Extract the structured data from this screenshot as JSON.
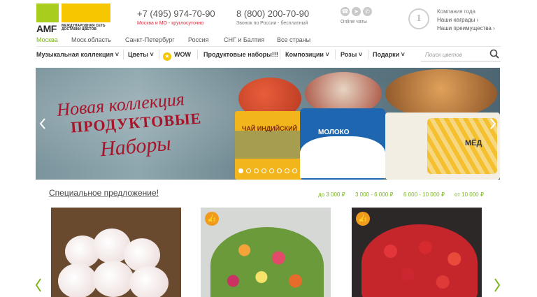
{
  "header": {
    "logo_text": "AMF",
    "logo_tagline": "Международная сеть доставки цветов",
    "phone1": "+7 (495) 974-70-90",
    "phone1_note": "Москва и МО - круглосуточно",
    "phone2": "8 (800) 200-70-90",
    "phone2_note": "Звонок по России - бесплатный",
    "chats_label": "Online чаты",
    "chat_icons": [
      "viber-icon",
      "telegram-icon",
      "whatsapp-icon"
    ],
    "company_title": "Компания года",
    "company_link1": "Наши награды ›",
    "company_link2": "Наши преимущества ›"
  },
  "cities": [
    "Москва",
    "Моск.область",
    "Санкт-Петербург",
    "Россия",
    "СНГ и Балтия",
    "Все страны"
  ],
  "nav": {
    "items": [
      {
        "label": "Музыкальная коллекция ˅"
      },
      {
        "label": "Цветы ˅"
      },
      {
        "label": "WOW"
      },
      {
        "label": "Продуктовые наборы!!!"
      },
      {
        "label": "Композиции ˅"
      },
      {
        "label": "Розы ˅"
      },
      {
        "label": "Подарки ˅"
      }
    ],
    "search_placeholder": "Поиск цветов"
  },
  "banner": {
    "line1": "Новая коллекция",
    "line2": "ПРОДУКТОВЫЕ",
    "line3": "Наборы",
    "box1_text": "ЧАЙ ИНДИЙСКИЙ",
    "box2_text": "МОЛОКО",
    "box3_text": "МЁД",
    "slides_total": 8,
    "active_slide": 1
  },
  "offer": {
    "title": "Специальное предложение!",
    "price_filters": [
      "до 3 000 ₽",
      "3 000 - 6 000 ₽",
      "6 000 - 10 000 ₽",
      "от 10 000 ₽"
    ]
  },
  "colors": {
    "accent_green": "#7ab51d",
    "brand_yellow": "#f6c600",
    "brand_lime": "#a9cd1c",
    "alert_red": "#d6293b",
    "thumb_orange": "#f19b1c"
  }
}
